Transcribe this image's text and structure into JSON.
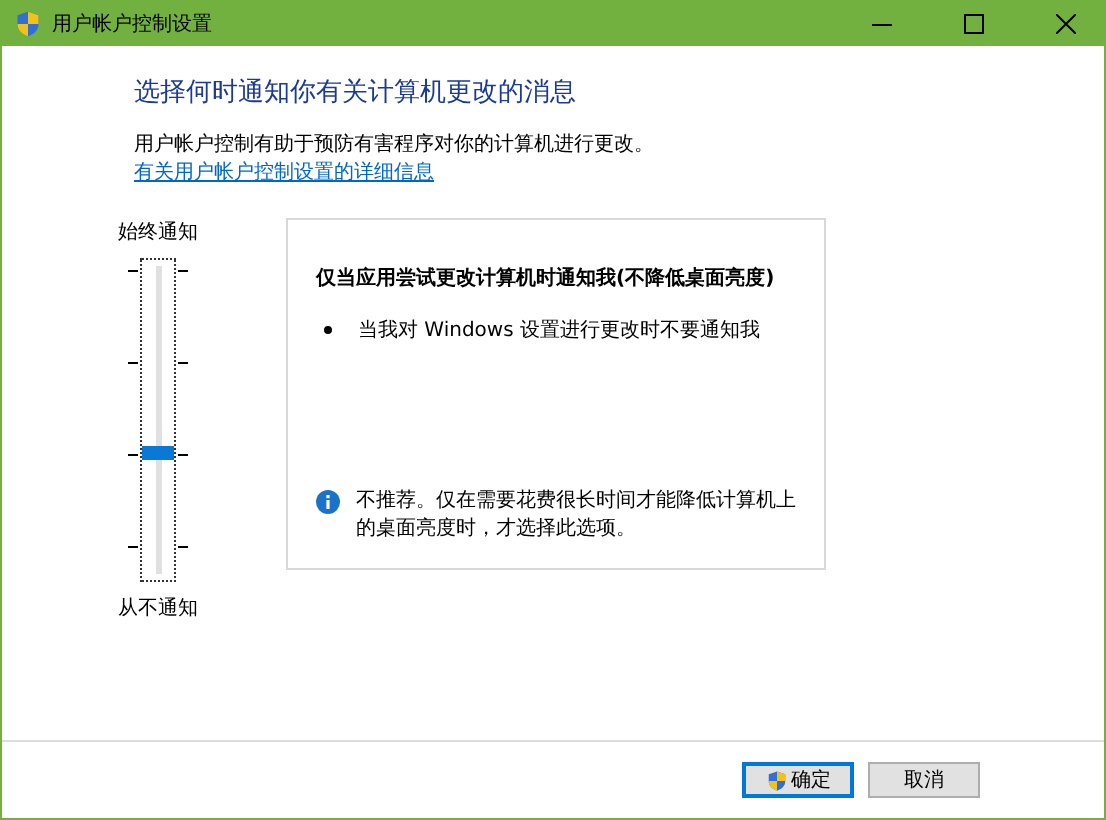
{
  "window": {
    "title": "用户帐户控制设置"
  },
  "heading": "选择何时通知你有关计算机更改的消息",
  "description": "用户帐户控制有助于预防有害程序对你的计算机进行更改。",
  "link": "有关用户帐户控制设置的详细信息",
  "slider": {
    "top_label": "始终通知",
    "bottom_label": "从不通知",
    "level": 0.333
  },
  "panel": {
    "title": "仅当应用尝试更改计算机时通知我(不降低桌面亮度)",
    "bullets": [
      "当我对 Windows 设置进行更改时不要通知我"
    ],
    "note": "不推荐。仅在需要花费很长时间才能降低计算机上的桌面亮度时，才选择此选项。"
  },
  "buttons": [
    {
      "label": "确定",
      "kind": "shield"
    },
    {
      "label": "取消",
      "kind": "plain"
    }
  ]
}
